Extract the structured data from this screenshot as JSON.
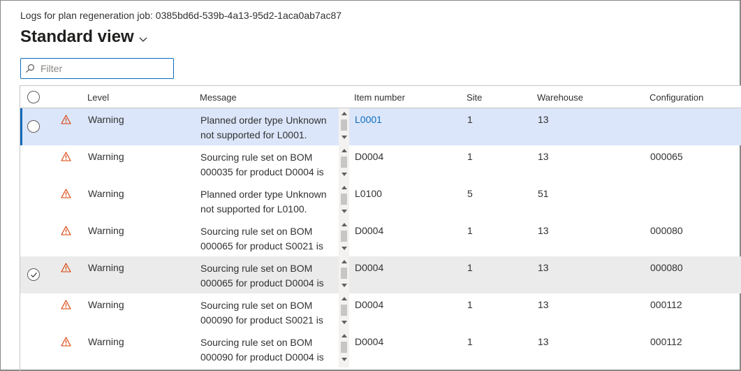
{
  "header": {
    "caption": "Logs for plan regeneration job: 0385bd6d-539b-4a13-95d2-1aca0ab7ac87",
    "view_title": "Standard view"
  },
  "filter": {
    "placeholder": "Filter",
    "value": ""
  },
  "columns": {
    "level": "Level",
    "message": "Message",
    "item_number": "Item number",
    "site": "Site",
    "warehouse": "Warehouse",
    "configuration": "Configuration"
  },
  "icons": {
    "warning": "warning-icon",
    "filter": "search-icon",
    "view_dropdown": "chevron-down-icon"
  },
  "colors": {
    "accent": "#0f6cbd",
    "warning": "#d83b01",
    "selected_row": "#dbe6fa",
    "checked_row": "#ebebeb"
  },
  "rows": [
    {
      "level": "Warning",
      "message": "Planned order type Unknown not supported for L0001.",
      "item": "L0001",
      "site": "1",
      "warehouse": "13",
      "config": "",
      "state": "active"
    },
    {
      "level": "Warning",
      "message": "Sourcing rule set on BOM 000035 for product D0004 is",
      "item": "D0004",
      "site": "1",
      "warehouse": "13",
      "config": "000065",
      "state": "normal"
    },
    {
      "level": "Warning",
      "message": "Planned order type Unknown not supported for L0100.",
      "item": "L0100",
      "site": "5",
      "warehouse": "51",
      "config": "",
      "state": "normal"
    },
    {
      "level": "Warning",
      "message": "Sourcing rule set on BOM 000065 for product S0021 is",
      "item": "D0004",
      "site": "1",
      "warehouse": "13",
      "config": "000080",
      "state": "normal"
    },
    {
      "level": "Warning",
      "message": "Sourcing rule set on BOM 000065 for product D0004 is",
      "item": "D0004",
      "site": "1",
      "warehouse": "13",
      "config": "000080",
      "state": "checked"
    },
    {
      "level": "Warning",
      "message": "Sourcing rule set on BOM 000090 for product S0021 is",
      "item": "D0004",
      "site": "1",
      "warehouse": "13",
      "config": "000112",
      "state": "normal"
    },
    {
      "level": "Warning",
      "message": "Sourcing rule set on BOM 000090 for product D0004 is",
      "item": "D0004",
      "site": "1",
      "warehouse": "13",
      "config": "000112",
      "state": "normal"
    }
  ]
}
